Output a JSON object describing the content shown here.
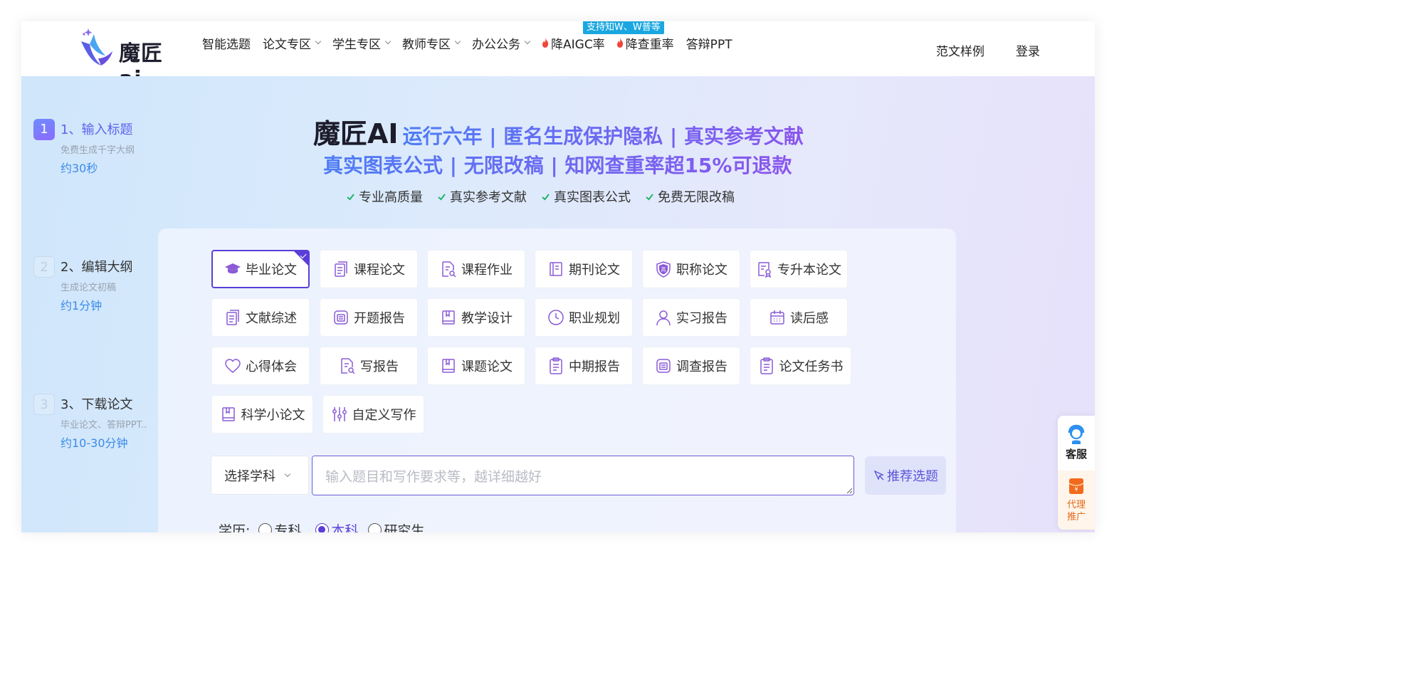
{
  "header": {
    "logo_text": "魔匠ai",
    "nav": [
      {
        "label": "智能选题",
        "has_dropdown": false
      },
      {
        "label": "论文专区",
        "has_dropdown": true
      },
      {
        "label": "学生专区",
        "has_dropdown": true
      },
      {
        "label": "教师专区",
        "has_dropdown": true
      },
      {
        "label": "办公公务",
        "has_dropdown": true
      },
      {
        "label": "降AIGC率",
        "hot": true
      },
      {
        "label": "降查重率",
        "hot": true
      },
      {
        "label": "答辩PPT",
        "has_dropdown": false
      }
    ],
    "badge": "支持知W、W普等",
    "samples_link": "范文样例",
    "login_link": "登录"
  },
  "steps": [
    {
      "num": "1",
      "title": "1、输入标题",
      "sub": "免费生成千字大纲",
      "time": "约30秒",
      "active": true
    },
    {
      "num": "2",
      "title": "2、编辑大纲",
      "sub": "生成论文初稿",
      "time": "约1分钟",
      "active": false
    },
    {
      "num": "3",
      "title": "3、下载论文",
      "sub": "毕业论文、答辩PPT..",
      "time": "约10-30分钟",
      "active": false
    }
  ],
  "hero": {
    "brand": "魔匠AI",
    "line1": "运行六年 | 匿名生成保护隐私 | 真实参考文献",
    "line2": "真实图表公式 | 无限改稿 | 知网查重率超15%可退款",
    "features": [
      "专业高质量",
      "真实参考文献",
      "真实图表公式",
      "免费无限改稿"
    ]
  },
  "paper_types": [
    {
      "label": "毕业论文",
      "icon": "graduation-cap-icon",
      "selected": true
    },
    {
      "label": "课程论文",
      "icon": "document-icon"
    },
    {
      "label": "课程作业",
      "icon": "document-search-icon"
    },
    {
      "label": "期刊论文",
      "icon": "journal-icon"
    },
    {
      "label": "职称论文",
      "icon": "shield-badge-icon"
    },
    {
      "label": "专升本论文",
      "icon": "certificate-icon"
    },
    {
      "label": "文献综述",
      "icon": "document-icon"
    },
    {
      "label": "开题报告",
      "icon": "report-icon"
    },
    {
      "label": "教学设计",
      "icon": "book-icon"
    },
    {
      "label": "职业规划",
      "icon": "clock-icon"
    },
    {
      "label": "实习报告",
      "icon": "user-icon"
    },
    {
      "label": "读后感",
      "icon": "calendar-icon"
    },
    {
      "label": "心得体会",
      "icon": "heart-icon"
    },
    {
      "label": "写报告",
      "icon": "document-search-icon"
    },
    {
      "label": "课题论文",
      "icon": "book-icon"
    },
    {
      "label": "中期报告",
      "icon": "clipboard-icon"
    },
    {
      "label": "调查报告",
      "icon": "report-icon"
    },
    {
      "label": "论文任务书",
      "icon": "clipboard-icon"
    },
    {
      "label": "科学小论文",
      "icon": "book-icon"
    },
    {
      "label": "自定义写作",
      "icon": "sliders-icon"
    }
  ],
  "form": {
    "subject_select": "选择学科",
    "topic_placeholder": "输入题目和写作要求等，越详细越好",
    "recommend_button": "推荐选题",
    "edu_label": "学历:",
    "edu_options": [
      {
        "label": "专科",
        "checked": false
      },
      {
        "label": "本科",
        "checked": true
      },
      {
        "label": "研究生",
        "checked": false
      }
    ]
  },
  "side_panel": {
    "service_label": "客服",
    "agent_label_1": "代理",
    "agent_label_2": "推广"
  },
  "colors": {
    "accent": "#5b3ed8",
    "icon_purple": "#8a5bd6",
    "link_blue": "#3a8be9",
    "badge_blue": "#1aa7e0"
  }
}
